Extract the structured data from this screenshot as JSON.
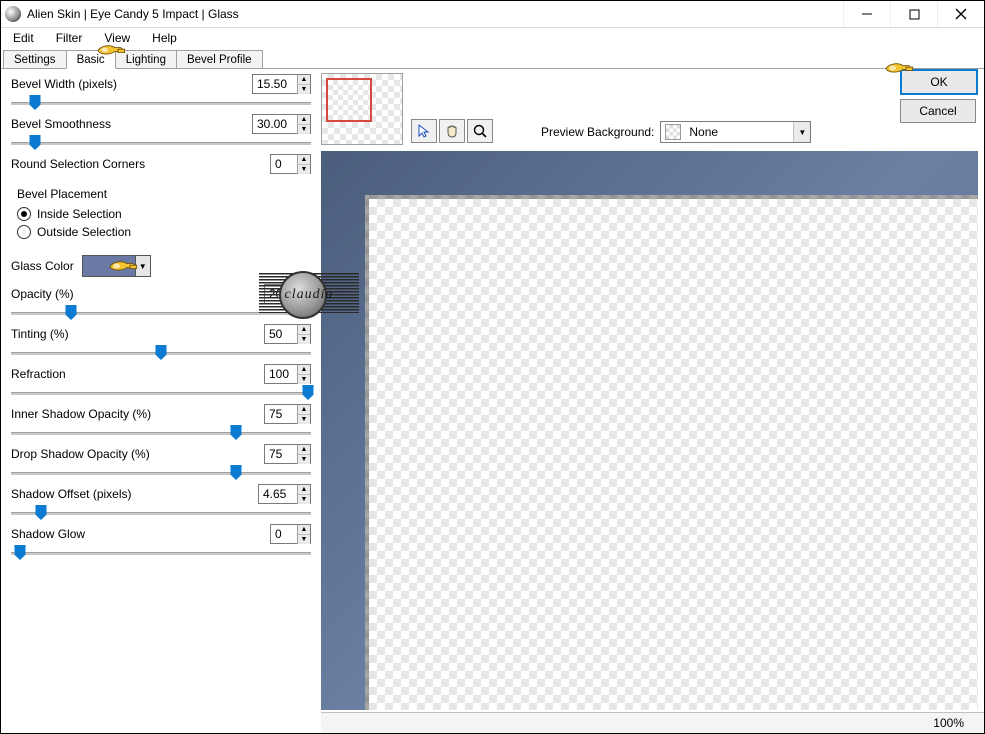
{
  "title": "Alien Skin | Eye Candy 5 Impact | Glass",
  "menu": {
    "edit": "Edit",
    "filter": "Filter",
    "view": "View",
    "help": "Help"
  },
  "tabs": {
    "settings": "Settings",
    "basic": "Basic",
    "lighting": "Lighting",
    "bevel_profile": "Bevel Profile"
  },
  "buttons": {
    "ok": "OK",
    "cancel": "Cancel"
  },
  "preview_bg": {
    "label": "Preview Background:",
    "value": "None"
  },
  "status": {
    "zoom": "100%"
  },
  "watermark_text": "claudia",
  "params": {
    "bevel_width": {
      "label": "Bevel Width (pixels)",
      "value": "15.50",
      "pos": 8
    },
    "bevel_smoothness": {
      "label": "Bevel Smoothness",
      "value": "30.00",
      "pos": 8
    },
    "round_corners": {
      "label": "Round Selection Corners",
      "value": "0",
      "pos": null
    },
    "bevel_placement": {
      "label": "Bevel Placement"
    },
    "placement_inside": {
      "label": "Inside Selection"
    },
    "placement_outside": {
      "label": "Outside Selection"
    },
    "glass_color": {
      "label": "Glass Color",
      "hex": "#6a7aa5"
    },
    "opacity": {
      "label": "Opacity (%)",
      "value": "20",
      "pos": 20
    },
    "tinting": {
      "label": "Tinting (%)",
      "value": "50",
      "pos": 50
    },
    "refraction": {
      "label": "Refraction",
      "value": "100",
      "pos": 100
    },
    "inner_shadow": {
      "label": "Inner Shadow Opacity (%)",
      "value": "75",
      "pos": 75
    },
    "drop_shadow": {
      "label": "Drop Shadow Opacity (%)",
      "value": "75",
      "pos": 75
    },
    "shadow_offset": {
      "label": "Shadow Offset (pixels)",
      "value": "4.65",
      "pos": 10
    },
    "shadow_glow": {
      "label": "Shadow Glow",
      "value": "0",
      "pos": 3
    }
  }
}
